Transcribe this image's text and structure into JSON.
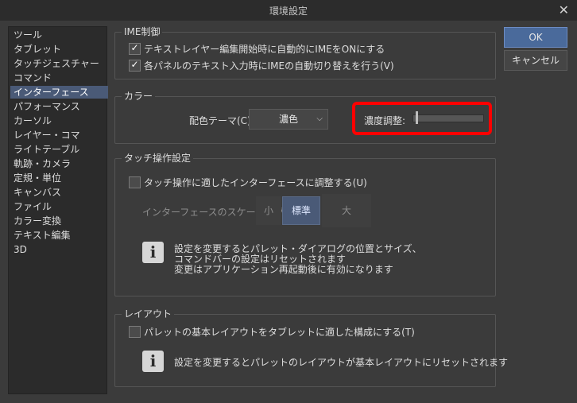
{
  "window": {
    "title": "環境設定",
    "close_glyph": "✕"
  },
  "sidebar": {
    "items": [
      {
        "label": "ツール"
      },
      {
        "label": "タブレット"
      },
      {
        "label": "タッチジェスチャー"
      },
      {
        "label": "コマンド"
      },
      {
        "label": "インターフェース",
        "selected": true
      },
      {
        "label": "パフォーマンス"
      },
      {
        "label": "カーソル"
      },
      {
        "label": "レイヤー・コマ"
      },
      {
        "label": "ライトテーブル"
      },
      {
        "label": "軌跡・カメラ"
      },
      {
        "label": "定規・単位"
      },
      {
        "label": "キャンバス"
      },
      {
        "label": "ファイル"
      },
      {
        "label": "カラー変換"
      },
      {
        "label": "テキスト編集"
      },
      {
        "label": "3D"
      }
    ]
  },
  "ime": {
    "title": "IME制御",
    "opt1": {
      "label": "テキストレイヤー編集開始時に自動的にIMEをONにする",
      "checked": true
    },
    "opt2": {
      "label": "各パネルのテキスト入力時にIMEの自動切り替えを行う(V)",
      "checked": true
    }
  },
  "color": {
    "title": "カラー",
    "theme_label": "配色テーマ(C):",
    "theme_value": "濃色",
    "density_label": "濃度調整:",
    "density_level": 0.05,
    "highlight_color": "#ff0000"
  },
  "touch": {
    "title": "タッチ操作設定",
    "checkbox_label": "タッチ操作に適したインターフェースに調整する(U)",
    "checked": false,
    "scaling_label": "インターフェースのスケーリング:",
    "scales": [
      "小",
      "標準",
      "大"
    ],
    "selected_scale": "標準",
    "info_line1": "設定を変更するとパレット・ダイアログの位置とサイズ、",
    "info_line2": "コマンドバーの設定はリセットされます",
    "info_line3": "変更はアプリケーション再起動後に有効になります"
  },
  "layout": {
    "title": "レイアウト",
    "checkbox_label": "パレットの基本レイアウトをタブレットに適した構成にする(T)",
    "checked": false,
    "info_text": "設定を変更するとパレットのレイアウトが基本レイアウトにリセットされます"
  },
  "buttons": {
    "ok": "OK",
    "cancel": "キャンセル"
  },
  "icons": {
    "info": "i",
    "check": "✓",
    "chevron": "⌵"
  }
}
